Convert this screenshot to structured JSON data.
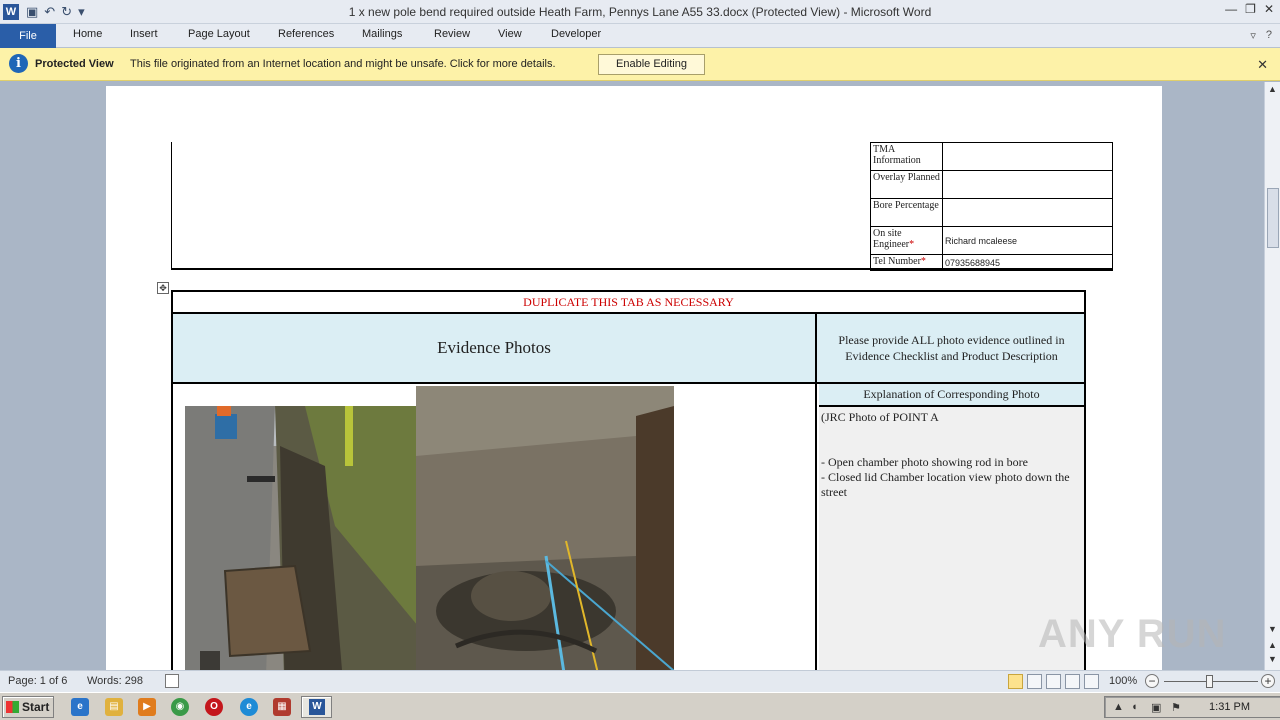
{
  "window": {
    "title": "1 x new pole bend required outside Heath Farm, Pennys Lane A55 33.docx (Protected View)  -  Microsoft Word",
    "app_icon": "word-icon"
  },
  "quick_access": [
    "save-icon",
    "undo-icon",
    "redo-icon",
    "customize-icon"
  ],
  "ribbon": {
    "tabs": [
      "File",
      "Home",
      "Insert",
      "Page Layout",
      "References",
      "Mailings",
      "Review",
      "View",
      "Developer"
    ]
  },
  "protected_view": {
    "label": "Protected View",
    "message": "This file originated from an Internet location and might be unsafe. Click for more details.",
    "button": "Enable Editing",
    "close": "✕"
  },
  "top_table": {
    "rows": [
      {
        "label": "TMA Information",
        "value": "",
        "required": false
      },
      {
        "label": "Overlay Planned",
        "value": "",
        "required": false
      },
      {
        "label": "Bore Percentage",
        "value": "",
        "required": false
      },
      {
        "label": "On site Engineer",
        "value": "Richard mcaleese",
        "required": true
      },
      {
        "label": "Tel Number",
        "value": "07935688945",
        "required": true
      }
    ],
    "required_mark": "*"
  },
  "evidence": {
    "duplicate_note": "DUPLICATE  THIS TAB AS NECESSARY",
    "title": "Evidence  Photos",
    "instruction": "Please provide ALL  photo evidence outlined in Evidence Checklist  and Product Description",
    "explanation_header": "Explanation  of Corresponding Photo",
    "explanation_lines": [
      "(JRC  Photo of POINT  A",
      "",
      "",
      "- Open chamber photo showing rod in bore",
      "- Closed lid Chamber location view photo down the street"
    ]
  },
  "statusbar": {
    "page": "Page: 1 of 6",
    "words": "Words: 298",
    "zoom": "100%",
    "zoom_level_percent": 100
  },
  "taskbar": {
    "start": "Start",
    "clock": "1:31 PM"
  },
  "watermark": "ANY RUN"
}
